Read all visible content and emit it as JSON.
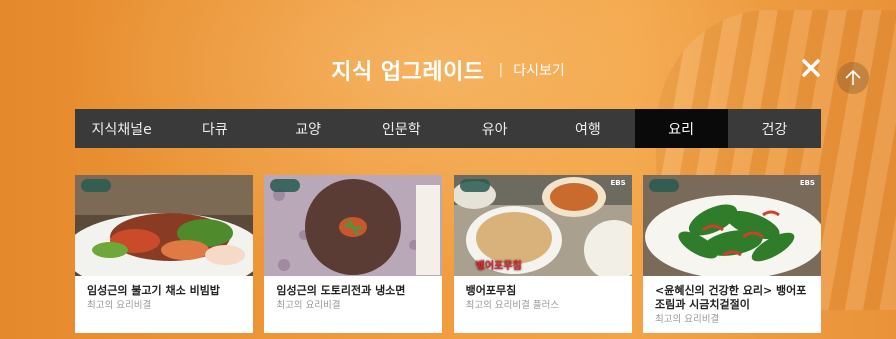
{
  "header": {
    "title": "지식 업그레이드",
    "separator": "|",
    "replay_label": "다시보기"
  },
  "icons": {
    "close": "close-icon",
    "scroll_top": "arrow-up-icon"
  },
  "tabs": [
    {
      "label": "지식채널e",
      "active": false
    },
    {
      "label": "다큐",
      "active": false
    },
    {
      "label": "교양",
      "active": false
    },
    {
      "label": "인문학",
      "active": false
    },
    {
      "label": "유아",
      "active": false
    },
    {
      "label": "여행",
      "active": false
    },
    {
      "label": "요리",
      "active": true
    },
    {
      "label": "건강",
      "active": false
    }
  ],
  "cards": [
    {
      "title": "임성근의 불고기 채소 비빔밥",
      "subtitle": "최고의 요리비결"
    },
    {
      "title": "임성근의 도토리전과 냉소면",
      "subtitle": "최고의 요리비결"
    },
    {
      "title": "뱅어포무침",
      "subtitle": "최고의 요리비결 플러스",
      "thumb_caption": "뱅어포무침"
    },
    {
      "title": "<윤혜신의 건강한 요리> 뱅어포 조림과 시금치겉절이",
      "subtitle": "최고의 요리비결"
    }
  ],
  "colors": {
    "background": "#ef9a3c",
    "tab_bar": "#3a3a3a",
    "tab_active": "#0a0a0a"
  }
}
